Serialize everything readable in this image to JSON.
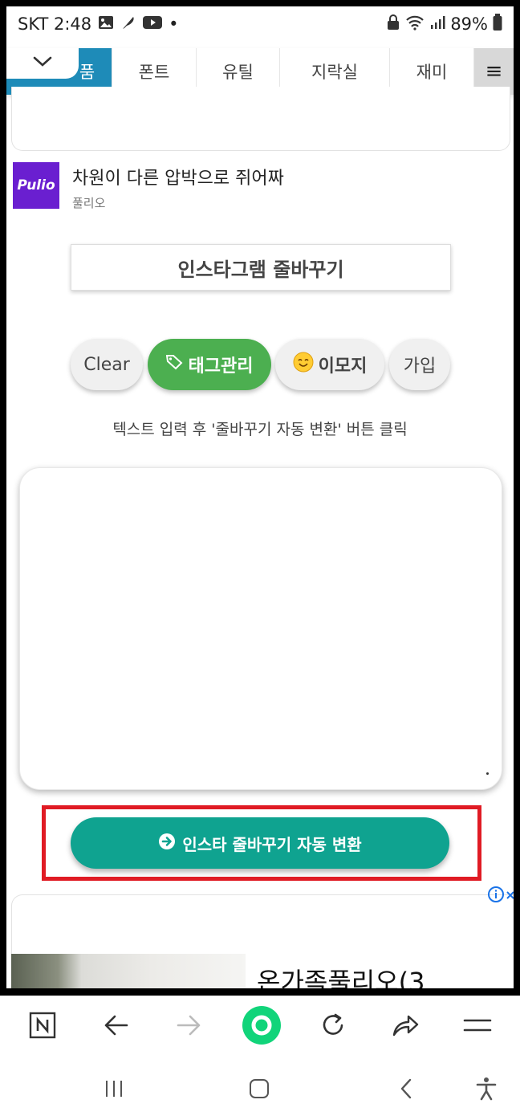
{
  "status_bar": {
    "carrier_time": "SKT 2:48",
    "dot": "•",
    "battery": "89%",
    "icons": [
      "gallery-icon",
      "feather-icon",
      "youtube-icon",
      "lock-icon",
      "wifi-icon",
      "signal-icon",
      "battery-icon"
    ]
  },
  "nav": {
    "tabs": [
      "폰트",
      "유틸",
      "지락실",
      "재미"
    ],
    "active_tab_partial": "품",
    "menu_glyph": "≡",
    "active_color": "#1e8bb8"
  },
  "promo": {
    "logo_text": "Pulio",
    "title": "차원이 다른 압박으로 쥐어짜",
    "sub": "풀리오"
  },
  "main": {
    "title": "인스타그램 줄바꾸기",
    "buttons": {
      "clear": "Clear",
      "tag": "태그관리",
      "emoji": "이모지",
      "join": "가입"
    },
    "hint": "텍스트 입력 후 '줄바꾸기 자동 변환' 버튼 클릭",
    "textarea_value": "",
    "convert_label": "인스타 줄바꾸기 자동 변환",
    "tag_color": "#4caf50",
    "convert_color": "#0fa390",
    "highlight_color": "#e01b24"
  },
  "ad_bottom": {
    "headline": "온가족풀리오(3"
  },
  "toolbar": {
    "icons": [
      "naver-icon",
      "back-arrow-icon",
      "forward-arrow-icon",
      "green-home-icon",
      "refresh-icon",
      "share-icon",
      "menu-icon"
    ]
  },
  "sys_nav": {
    "icons": [
      "recent-apps-icon",
      "home-icon",
      "back-icon",
      "accessibility-icon"
    ]
  }
}
